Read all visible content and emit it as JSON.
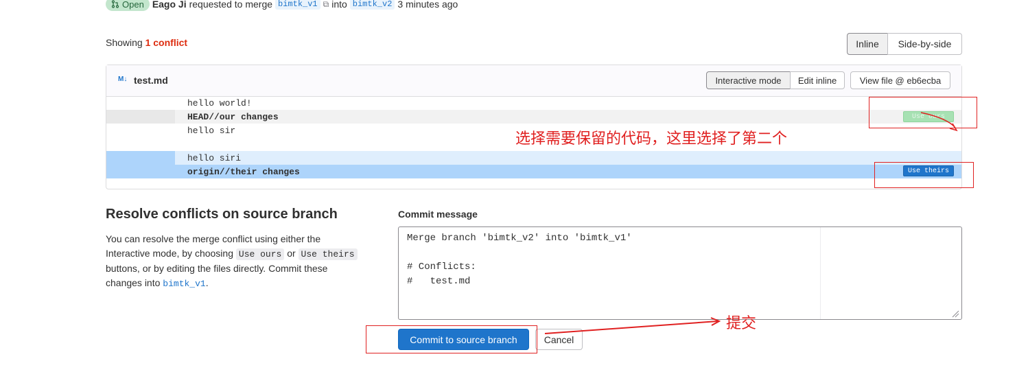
{
  "header": {
    "status_badge": "Open",
    "author": "Eago Ji",
    "requested_text": "requested to merge",
    "source_branch": "bimtk_v1",
    "into_text": "into",
    "target_branch": "bimtk_v2",
    "time_ago": "3 minutes ago"
  },
  "conflicts": {
    "showing_label": "Showing",
    "count_label": "1 conflict"
  },
  "view_toggle": {
    "inline": "Inline",
    "side_by_side": "Side-by-side",
    "active": "inline"
  },
  "file": {
    "icon": "markdown-icon",
    "icon_glyph": "M↓",
    "name": "test.md",
    "interactive_mode": "Interactive mode",
    "edit_inline": "Edit inline",
    "view_file": "View file @ eb6ecba"
  },
  "diff_lines": {
    "l1": "hello world!",
    "l2": "HEAD//our changes",
    "l3": "hello sir",
    "l4": "",
    "l5": "hello siri",
    "l6": "origin//their changes"
  },
  "resolve_buttons": {
    "use_ours": "Use ours",
    "use_theirs": "Use theirs"
  },
  "annotations": {
    "choose_note": "选择需要保留的代码，这里选择了第二个",
    "submit_note": "提交"
  },
  "resolve_section": {
    "title": "Resolve conflicts on source branch",
    "desc_1": "You can resolve the merge conflict using either the",
    "desc_2a": "Interactive mode, by choosing",
    "use_ours": "Use ours",
    "desc_2b": "or",
    "use_theirs": "Use theirs",
    "desc_3": "buttons, or by editing the files directly. Commit these",
    "desc_4a": "changes into",
    "branch": "bimtk_v1",
    "desc_4b": "."
  },
  "commit": {
    "label": "Commit message",
    "line1": "Merge branch 'bimtk_v2' into 'bimtk_v1'",
    "line2": "",
    "line3": "# Conflicts:",
    "line4": "#   test.md",
    "submit": "Commit to source branch",
    "cancel": "Cancel"
  },
  "colors": {
    "accent": "#1f75cb",
    "danger": "#dd2b0e",
    "annotation": "#e02020"
  }
}
